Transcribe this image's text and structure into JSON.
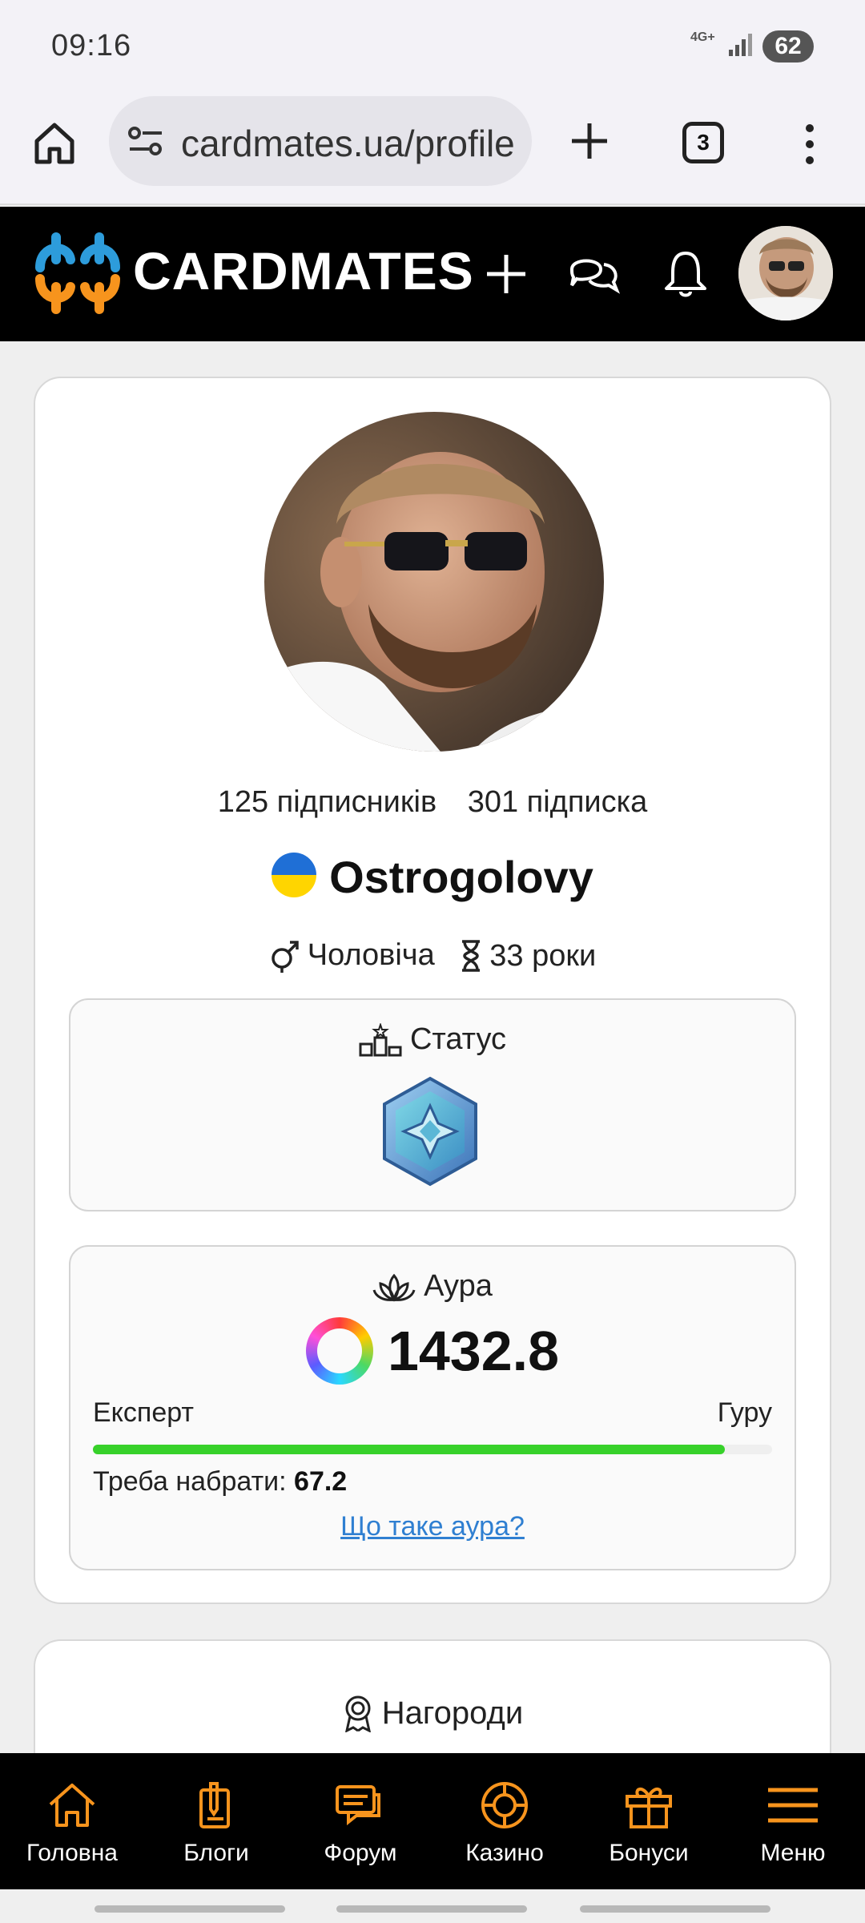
{
  "status_bar": {
    "time": "09:16",
    "network": "4G+",
    "battery": "62"
  },
  "browser": {
    "url": "cardmates.ua/profile",
    "tab_count": "3"
  },
  "site": {
    "brand": "CARDMATES"
  },
  "profile": {
    "followers": "125 підписників",
    "following": "301 підписка",
    "username": "Ostrogolovy",
    "gender": "Чоловіча",
    "age": "33 роки"
  },
  "status_box": {
    "title": "Статус"
  },
  "aura_box": {
    "title": "Аура",
    "value": "1432.8",
    "level_from": "Експерт",
    "level_to": "Гуру",
    "progress_percent": 93,
    "need_label": "Треба набрати:",
    "need_value": "67.2",
    "help_link": "Що таке аура?"
  },
  "awards": {
    "title": "Нагороди"
  },
  "bottom_nav": {
    "items": [
      {
        "label": "Головна",
        "icon": "home-icon"
      },
      {
        "label": "Блоги",
        "icon": "blog-icon"
      },
      {
        "label": "Форум",
        "icon": "forum-icon"
      },
      {
        "label": "Казино",
        "icon": "casino-icon"
      },
      {
        "label": "Бонуси",
        "icon": "gift-icon"
      },
      {
        "label": "Меню",
        "icon": "menu-icon"
      }
    ]
  },
  "colors": {
    "accent_orange": "#f7941d",
    "logo_blue": "#2d9cdb",
    "progress_green": "#37d12a",
    "link_blue": "#2f7fd1",
    "header_black": "#000000"
  }
}
